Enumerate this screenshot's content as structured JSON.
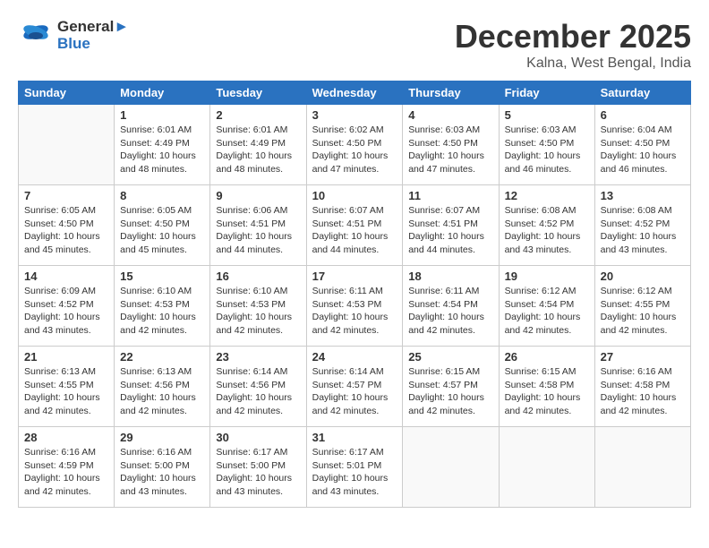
{
  "logo": {
    "line1": "General",
    "line2": "Blue"
  },
  "title": "December 2025",
  "location": "Kalna, West Bengal, India",
  "days_of_week": [
    "Sunday",
    "Monday",
    "Tuesday",
    "Wednesday",
    "Thursday",
    "Friday",
    "Saturday"
  ],
  "weeks": [
    [
      {
        "day": "",
        "info": ""
      },
      {
        "day": "1",
        "info": "Sunrise: 6:01 AM\nSunset: 4:49 PM\nDaylight: 10 hours\nand 48 minutes."
      },
      {
        "day": "2",
        "info": "Sunrise: 6:01 AM\nSunset: 4:49 PM\nDaylight: 10 hours\nand 48 minutes."
      },
      {
        "day": "3",
        "info": "Sunrise: 6:02 AM\nSunset: 4:50 PM\nDaylight: 10 hours\nand 47 minutes."
      },
      {
        "day": "4",
        "info": "Sunrise: 6:03 AM\nSunset: 4:50 PM\nDaylight: 10 hours\nand 47 minutes."
      },
      {
        "day": "5",
        "info": "Sunrise: 6:03 AM\nSunset: 4:50 PM\nDaylight: 10 hours\nand 46 minutes."
      },
      {
        "day": "6",
        "info": "Sunrise: 6:04 AM\nSunset: 4:50 PM\nDaylight: 10 hours\nand 46 minutes."
      }
    ],
    [
      {
        "day": "7",
        "info": "Sunrise: 6:05 AM\nSunset: 4:50 PM\nDaylight: 10 hours\nand 45 minutes."
      },
      {
        "day": "8",
        "info": "Sunrise: 6:05 AM\nSunset: 4:50 PM\nDaylight: 10 hours\nand 45 minutes."
      },
      {
        "day": "9",
        "info": "Sunrise: 6:06 AM\nSunset: 4:51 PM\nDaylight: 10 hours\nand 44 minutes."
      },
      {
        "day": "10",
        "info": "Sunrise: 6:07 AM\nSunset: 4:51 PM\nDaylight: 10 hours\nand 44 minutes."
      },
      {
        "day": "11",
        "info": "Sunrise: 6:07 AM\nSunset: 4:51 PM\nDaylight: 10 hours\nand 44 minutes."
      },
      {
        "day": "12",
        "info": "Sunrise: 6:08 AM\nSunset: 4:52 PM\nDaylight: 10 hours\nand 43 minutes."
      },
      {
        "day": "13",
        "info": "Sunrise: 6:08 AM\nSunset: 4:52 PM\nDaylight: 10 hours\nand 43 minutes."
      }
    ],
    [
      {
        "day": "14",
        "info": "Sunrise: 6:09 AM\nSunset: 4:52 PM\nDaylight: 10 hours\nand 43 minutes."
      },
      {
        "day": "15",
        "info": "Sunrise: 6:10 AM\nSunset: 4:53 PM\nDaylight: 10 hours\nand 42 minutes."
      },
      {
        "day": "16",
        "info": "Sunrise: 6:10 AM\nSunset: 4:53 PM\nDaylight: 10 hours\nand 42 minutes."
      },
      {
        "day": "17",
        "info": "Sunrise: 6:11 AM\nSunset: 4:53 PM\nDaylight: 10 hours\nand 42 minutes."
      },
      {
        "day": "18",
        "info": "Sunrise: 6:11 AM\nSunset: 4:54 PM\nDaylight: 10 hours\nand 42 minutes."
      },
      {
        "day": "19",
        "info": "Sunrise: 6:12 AM\nSunset: 4:54 PM\nDaylight: 10 hours\nand 42 minutes."
      },
      {
        "day": "20",
        "info": "Sunrise: 6:12 AM\nSunset: 4:55 PM\nDaylight: 10 hours\nand 42 minutes."
      }
    ],
    [
      {
        "day": "21",
        "info": "Sunrise: 6:13 AM\nSunset: 4:55 PM\nDaylight: 10 hours\nand 42 minutes."
      },
      {
        "day": "22",
        "info": "Sunrise: 6:13 AM\nSunset: 4:56 PM\nDaylight: 10 hours\nand 42 minutes."
      },
      {
        "day": "23",
        "info": "Sunrise: 6:14 AM\nSunset: 4:56 PM\nDaylight: 10 hours\nand 42 minutes."
      },
      {
        "day": "24",
        "info": "Sunrise: 6:14 AM\nSunset: 4:57 PM\nDaylight: 10 hours\nand 42 minutes."
      },
      {
        "day": "25",
        "info": "Sunrise: 6:15 AM\nSunset: 4:57 PM\nDaylight: 10 hours\nand 42 minutes."
      },
      {
        "day": "26",
        "info": "Sunrise: 6:15 AM\nSunset: 4:58 PM\nDaylight: 10 hours\nand 42 minutes."
      },
      {
        "day": "27",
        "info": "Sunrise: 6:16 AM\nSunset: 4:58 PM\nDaylight: 10 hours\nand 42 minutes."
      }
    ],
    [
      {
        "day": "28",
        "info": "Sunrise: 6:16 AM\nSunset: 4:59 PM\nDaylight: 10 hours\nand 42 minutes."
      },
      {
        "day": "29",
        "info": "Sunrise: 6:16 AM\nSunset: 5:00 PM\nDaylight: 10 hours\nand 43 minutes."
      },
      {
        "day": "30",
        "info": "Sunrise: 6:17 AM\nSunset: 5:00 PM\nDaylight: 10 hours\nand 43 minutes."
      },
      {
        "day": "31",
        "info": "Sunrise: 6:17 AM\nSunset: 5:01 PM\nDaylight: 10 hours\nand 43 minutes."
      },
      {
        "day": "",
        "info": ""
      },
      {
        "day": "",
        "info": ""
      },
      {
        "day": "",
        "info": ""
      }
    ]
  ]
}
